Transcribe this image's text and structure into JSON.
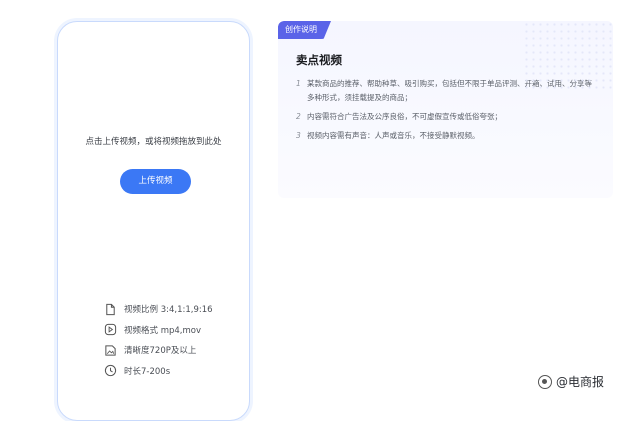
{
  "upload": {
    "hint": "点击上传视频，或将视频拖放到此处",
    "button_label": "上传视频",
    "specs": [
      {
        "icon": "file-icon",
        "text": "视频比例 3:4,1:1,9:16"
      },
      {
        "icon": "play-icon",
        "text": "视频格式 mp4,mov"
      },
      {
        "icon": "image-icon",
        "text": "清晰度720P及以上"
      },
      {
        "icon": "clock-icon",
        "text": "时长7-200s"
      }
    ]
  },
  "info": {
    "tag": "创作说明",
    "title": "卖点视频",
    "rules": [
      {
        "num": "1",
        "text": "某款商品的推荐、帮助种草、吸引购买，包括但不限于单品评测、开箱、试用、分享等多种形式，须挂载提及的商品；"
      },
      {
        "num": "2",
        "text": "内容需符合广告法及公序良俗，不可虚假宣传或低俗夸张；"
      },
      {
        "num": "3",
        "text": "视频内容需有声音：人声或音乐，不接受静默视频。"
      }
    ]
  },
  "watermark": {
    "text": "@电商报"
  }
}
